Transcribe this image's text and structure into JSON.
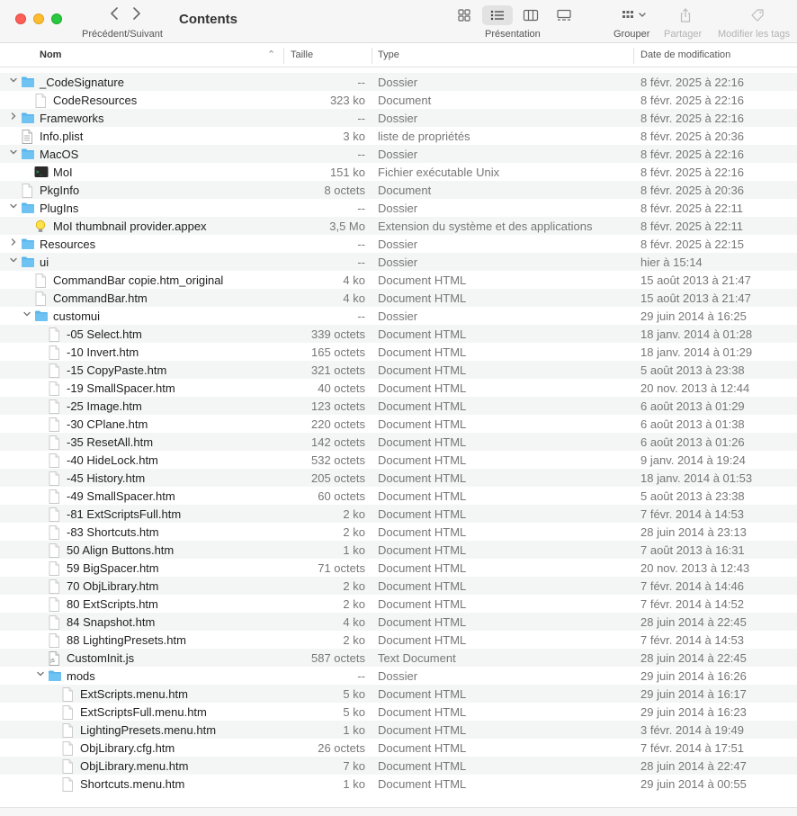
{
  "window": {
    "title": "Contents",
    "nav_label": "Précédent/Suivant",
    "view_label": "Présentation",
    "group_label": "Grouper",
    "share_label": "Partager",
    "tags_label": "Modifier les tags"
  },
  "columns": {
    "name": "Nom",
    "size": "Taille",
    "type": "Type",
    "date": "Date de modification"
  },
  "rows": [
    {
      "name": "_CodeSignature",
      "size": "--",
      "type": "Dossier",
      "date": "8 févr. 2025 à 22:16",
      "level": 0,
      "disclosure": "open",
      "icon": "folder"
    },
    {
      "name": "CodeResources",
      "size": "323 ko",
      "type": "Document",
      "date": "8 févr. 2025 à 22:16",
      "level": 1,
      "disclosure": "none",
      "icon": "doc"
    },
    {
      "name": "Frameworks",
      "size": "--",
      "type": "Dossier",
      "date": "8 févr. 2025 à 22:16",
      "level": 0,
      "disclosure": "closed",
      "icon": "folder"
    },
    {
      "name": "Info.plist",
      "size": "3 ko",
      "type": "liste de propriétés",
      "date": "8 févr. 2025 à 20:36",
      "level": 0,
      "disclosure": "none",
      "icon": "plist"
    },
    {
      "name": "MacOS",
      "size": "--",
      "type": "Dossier",
      "date": "8 févr. 2025 à 22:16",
      "level": 0,
      "disclosure": "open",
      "icon": "folder"
    },
    {
      "name": "MoI",
      "size": "151 ko",
      "type": "Fichier exécutable Unix",
      "date": "8 févr. 2025 à 22:16",
      "level": 1,
      "disclosure": "none",
      "icon": "exec"
    },
    {
      "name": "PkgInfo",
      "size": "8 octets",
      "type": "Document",
      "date": "8 févr. 2025 à 20:36",
      "level": 0,
      "disclosure": "none",
      "icon": "doc"
    },
    {
      "name": "PlugIns",
      "size": "--",
      "type": "Dossier",
      "date": "8 févr. 2025 à 22:11",
      "level": 0,
      "disclosure": "open",
      "icon": "folder"
    },
    {
      "name": "MoI thumbnail provider.appex",
      "size": "3,5 Mo",
      "type": "Extension du système et des applications",
      "date": "8 févr. 2025 à 22:11",
      "level": 1,
      "disclosure": "none",
      "icon": "bulb"
    },
    {
      "name": "Resources",
      "size": "--",
      "type": "Dossier",
      "date": "8 févr. 2025 à 22:15",
      "level": 0,
      "disclosure": "closed",
      "icon": "folder"
    },
    {
      "name": "ui",
      "size": "--",
      "type": "Dossier",
      "date": "hier à 15:14",
      "level": 0,
      "disclosure": "open",
      "icon": "folder"
    },
    {
      "name": "CommandBar copie.htm_original",
      "size": "4 ko",
      "type": "Document HTML",
      "date": "15 août 2013 à 21:47",
      "level": 1,
      "disclosure": "none",
      "icon": "doc"
    },
    {
      "name": "CommandBar.htm",
      "size": "4 ko",
      "type": "Document HTML",
      "date": "15 août 2013 à 21:47",
      "level": 1,
      "disclosure": "none",
      "icon": "doc"
    },
    {
      "name": "customui",
      "size": "--",
      "type": "Dossier",
      "date": "29 juin 2014 à 16:25",
      "level": 1,
      "disclosure": "open",
      "icon": "folder"
    },
    {
      "name": "-05 Select.htm",
      "size": "339 octets",
      "type": "Document HTML",
      "date": "18 janv. 2014 à 01:28",
      "level": 2,
      "disclosure": "none",
      "icon": "doc"
    },
    {
      "name": "-10 Invert.htm",
      "size": "165 octets",
      "type": "Document HTML",
      "date": "18 janv. 2014 à 01:29",
      "level": 2,
      "disclosure": "none",
      "icon": "doc"
    },
    {
      "name": "-15 CopyPaste.htm",
      "size": "321 octets",
      "type": "Document HTML",
      "date": "5 août 2013 à 23:38",
      "level": 2,
      "disclosure": "none",
      "icon": "doc"
    },
    {
      "name": "-19 SmallSpacer.htm",
      "size": "40 octets",
      "type": "Document HTML",
      "date": "20 nov. 2013 à 12:44",
      "level": 2,
      "disclosure": "none",
      "icon": "doc"
    },
    {
      "name": "-25 Image.htm",
      "size": "123 octets",
      "type": "Document HTML",
      "date": "6 août 2013 à 01:29",
      "level": 2,
      "disclosure": "none",
      "icon": "doc"
    },
    {
      "name": "-30 CPlane.htm",
      "size": "220 octets",
      "type": "Document HTML",
      "date": "6 août 2013 à 01:38",
      "level": 2,
      "disclosure": "none",
      "icon": "doc"
    },
    {
      "name": "-35 ResetAll.htm",
      "size": "142 octets",
      "type": "Document HTML",
      "date": "6 août 2013 à 01:26",
      "level": 2,
      "disclosure": "none",
      "icon": "doc"
    },
    {
      "name": "-40 HideLock.htm",
      "size": "532 octets",
      "type": "Document HTML",
      "date": "9 janv. 2014 à 19:24",
      "level": 2,
      "disclosure": "none",
      "icon": "doc"
    },
    {
      "name": "-45 History.htm",
      "size": "205 octets",
      "type": "Document HTML",
      "date": "18 janv. 2014 à 01:53",
      "level": 2,
      "disclosure": "none",
      "icon": "doc"
    },
    {
      "name": "-49 SmallSpacer.htm",
      "size": "60 octets",
      "type": "Document HTML",
      "date": "5 août 2013 à 23:38",
      "level": 2,
      "disclosure": "none",
      "icon": "doc"
    },
    {
      "name": "-81 ExtScriptsFull.htm",
      "size": "2 ko",
      "type": "Document HTML",
      "date": "7 févr. 2014 à 14:53",
      "level": 2,
      "disclosure": "none",
      "icon": "doc"
    },
    {
      "name": "-83 Shortcuts.htm",
      "size": "2 ko",
      "type": "Document HTML",
      "date": "28 juin 2014 à 23:13",
      "level": 2,
      "disclosure": "none",
      "icon": "doc"
    },
    {
      "name": "50 Align Buttons.htm",
      "size": "1 ko",
      "type": "Document HTML",
      "date": "7 août 2013 à 16:31",
      "level": 2,
      "disclosure": "none",
      "icon": "doc"
    },
    {
      "name": "59 BigSpacer.htm",
      "size": "71 octets",
      "type": "Document HTML",
      "date": "20 nov. 2013 à 12:43",
      "level": 2,
      "disclosure": "none",
      "icon": "doc"
    },
    {
      "name": "70 ObjLibrary.htm",
      "size": "2 ko",
      "type": "Document HTML",
      "date": "7 févr. 2014 à 14:46",
      "level": 2,
      "disclosure": "none",
      "icon": "doc"
    },
    {
      "name": "80 ExtScripts.htm",
      "size": "2 ko",
      "type": "Document HTML",
      "date": "7 févr. 2014 à 14:52",
      "level": 2,
      "disclosure": "none",
      "icon": "doc"
    },
    {
      "name": "84 Snapshot.htm",
      "size": "4 ko",
      "type": "Document HTML",
      "date": "28 juin 2014 à 22:45",
      "level": 2,
      "disclosure": "none",
      "icon": "doc"
    },
    {
      "name": "88 LightingPresets.htm",
      "size": "2 ko",
      "type": "Document HTML",
      "date": "7 févr. 2014 à 14:53",
      "level": 2,
      "disclosure": "none",
      "icon": "doc"
    },
    {
      "name": "CustomInit.js",
      "size": "587 octets",
      "type": "Text Document",
      "date": "28 juin 2014 à 22:45",
      "level": 2,
      "disclosure": "none",
      "icon": "js"
    },
    {
      "name": "mods",
      "size": "--",
      "type": "Dossier",
      "date": "29 juin 2014 à 16:26",
      "level": 2,
      "disclosure": "open",
      "icon": "folder"
    },
    {
      "name": "ExtScripts.menu.htm",
      "size": "5 ko",
      "type": "Document HTML",
      "date": "29 juin 2014 à 16:17",
      "level": 3,
      "disclosure": "none",
      "icon": "doc"
    },
    {
      "name": "ExtScriptsFull.menu.htm",
      "size": "5 ko",
      "type": "Document HTML",
      "date": "29 juin 2014 à 16:23",
      "level": 3,
      "disclosure": "none",
      "icon": "doc"
    },
    {
      "name": "LightingPresets.menu.htm",
      "size": "1 ko",
      "type": "Document HTML",
      "date": "3 févr. 2014 à 19:49",
      "level": 3,
      "disclosure": "none",
      "icon": "doc"
    },
    {
      "name": "ObjLibrary.cfg.htm",
      "size": "26 octets",
      "type": "Document HTML",
      "date": "7 févr. 2014 à 17:51",
      "level": 3,
      "disclosure": "none",
      "icon": "doc"
    },
    {
      "name": "ObjLibrary.menu.htm",
      "size": "7 ko",
      "type": "Document HTML",
      "date": "28 juin 2014 à 22:47",
      "level": 3,
      "disclosure": "none",
      "icon": "doc"
    },
    {
      "name": "Shortcuts.menu.htm",
      "size": "1 ko",
      "type": "Document HTML",
      "date": "29 juin 2014 à 00:55",
      "level": 3,
      "disclosure": "none",
      "icon": "doc"
    }
  ],
  "colors": {
    "folder": "#5ab6ec",
    "alt_row": "#f4f5f5",
    "secondary_text": "#777777"
  }
}
